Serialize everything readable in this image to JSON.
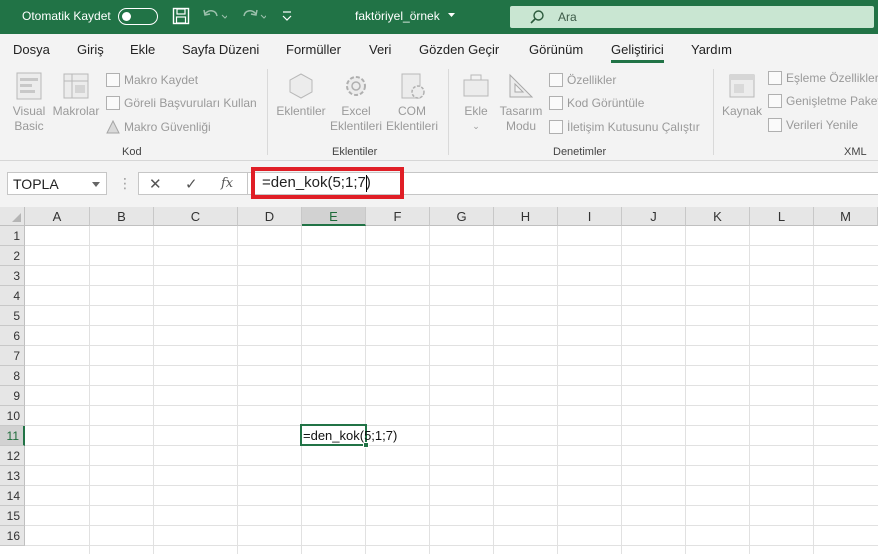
{
  "titlebar": {
    "autosave_label": "Otomatik Kaydet",
    "filename": "faktöriyel_örnek",
    "search_placeholder": "Ara",
    "icons": [
      "save-icon",
      "undo-icon",
      "redo-icon",
      "customize-icon",
      "search-icon"
    ]
  },
  "tabs": [
    "Dosya",
    "Giriş",
    "Ekle",
    "Sayfa Düzeni",
    "Formüller",
    "Veri",
    "Gözden Geçir",
    "Görünüm",
    "Geliştirici",
    "Yardım"
  ],
  "active_tab": "Geliştirici",
  "ribbon": {
    "kod": {
      "label": "Kod",
      "visual_basic": [
        "Visual",
        "Basic"
      ],
      "makrolar": "Makrolar",
      "makro_kaydet": "Makro Kaydet",
      "goreli": "Göreli Başvuruları Kullan",
      "makro_guvenligi": "Makro Güvenliği"
    },
    "eklentiler": {
      "label": "Eklentiler",
      "eklentiler": "Eklentiler",
      "excel_eklentileri": [
        "Excel",
        "Eklentileri"
      ],
      "com_eklentileri": [
        "COM",
        "Eklentileri"
      ]
    },
    "denetimler": {
      "label": "Denetimler",
      "ekle": "Ekle",
      "tasarim_modu": [
        "Tasarım",
        "Modu"
      ],
      "ozellikler": "Özellikler",
      "kod_goruntule": "Kod Görüntüle",
      "iletisim": "İletişim Kutusunu Çalıştır"
    },
    "xml": {
      "label": "XML",
      "kaynak": "Kaynak",
      "esleme": "Eşleme Özellikleri",
      "genisletme": "Genişletme Paket",
      "verileri_yenile": "Verileri Yenile"
    }
  },
  "formula_bar": {
    "name_box": "TOPLA",
    "formula": "=den_kok(5;1;7)",
    "fx_label": "fx"
  },
  "sheet": {
    "columns": [
      "A",
      "B",
      "C",
      "D",
      "E",
      "F",
      "G",
      "H",
      "I",
      "J",
      "K",
      "L",
      "M"
    ],
    "rows": [
      "1",
      "2",
      "3",
      "4",
      "5",
      "6",
      "7",
      "8",
      "9",
      "10",
      "11",
      "12",
      "13",
      "14",
      "15",
      "16"
    ],
    "active_cell": "E11",
    "active_cell_value": "=den_kok(5;1;7)"
  },
  "colors": {
    "brand": "#217346",
    "highlight": "#e01e26"
  }
}
